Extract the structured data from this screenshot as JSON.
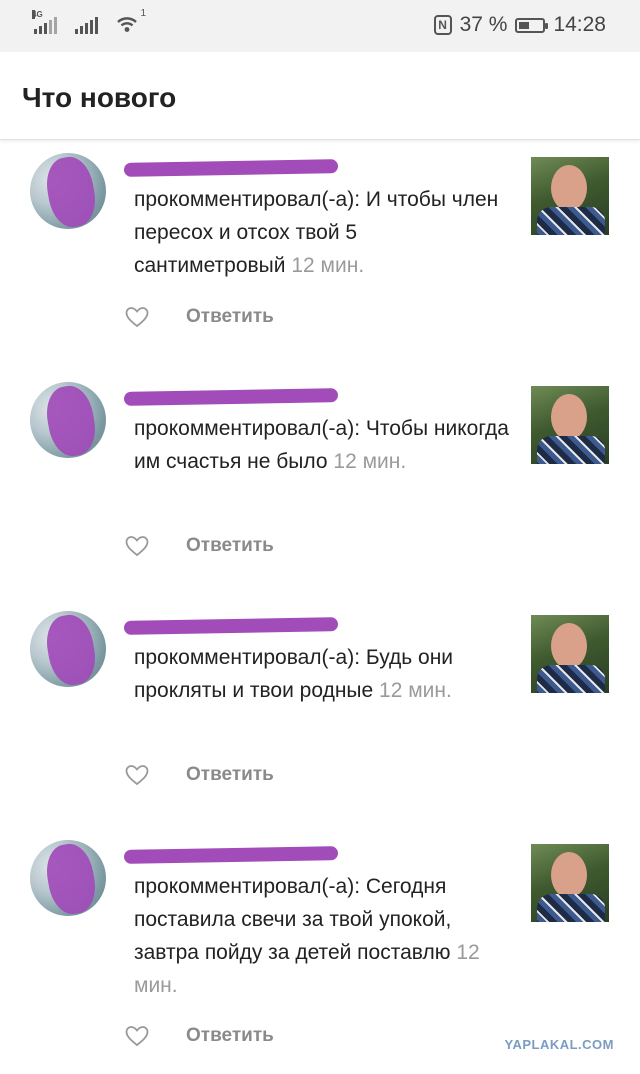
{
  "status_bar": {
    "network_type": "4G",
    "wifi_badge": "1",
    "battery_text": "37 %",
    "battery_level": 0.37,
    "time": "14:28"
  },
  "header": {
    "title": "Что нового"
  },
  "feed": {
    "items": [
      {
        "comment": "прокомментировал(-а): И чтобы член пересох и отсох твой 5 сантиметровый",
        "time": "12 мин.",
        "reply_label": "Ответить"
      },
      {
        "comment": "прокомментировал(-а): Чтобы никогда им счастья не было",
        "time": "12 мин.",
        "reply_label": "Ответить"
      },
      {
        "comment": "прокомментировал(-а): Будь они прокляты и твои родные",
        "time": "12 мин.",
        "reply_label": "Ответить"
      },
      {
        "comment": "прокомментировал(-а): Сегодня поставила свечи за твой упокой, завтра пойду за детей поставлю",
        "time": "12 мин.",
        "reply_label": "Ответить"
      }
    ]
  },
  "watermark": "YAPLAKAL.COM",
  "icons": {
    "like": "heart-outline-icon",
    "signal": "signal-icon",
    "wifi": "wifi-icon",
    "nfc": "nfc-icon",
    "battery": "battery-icon"
  }
}
